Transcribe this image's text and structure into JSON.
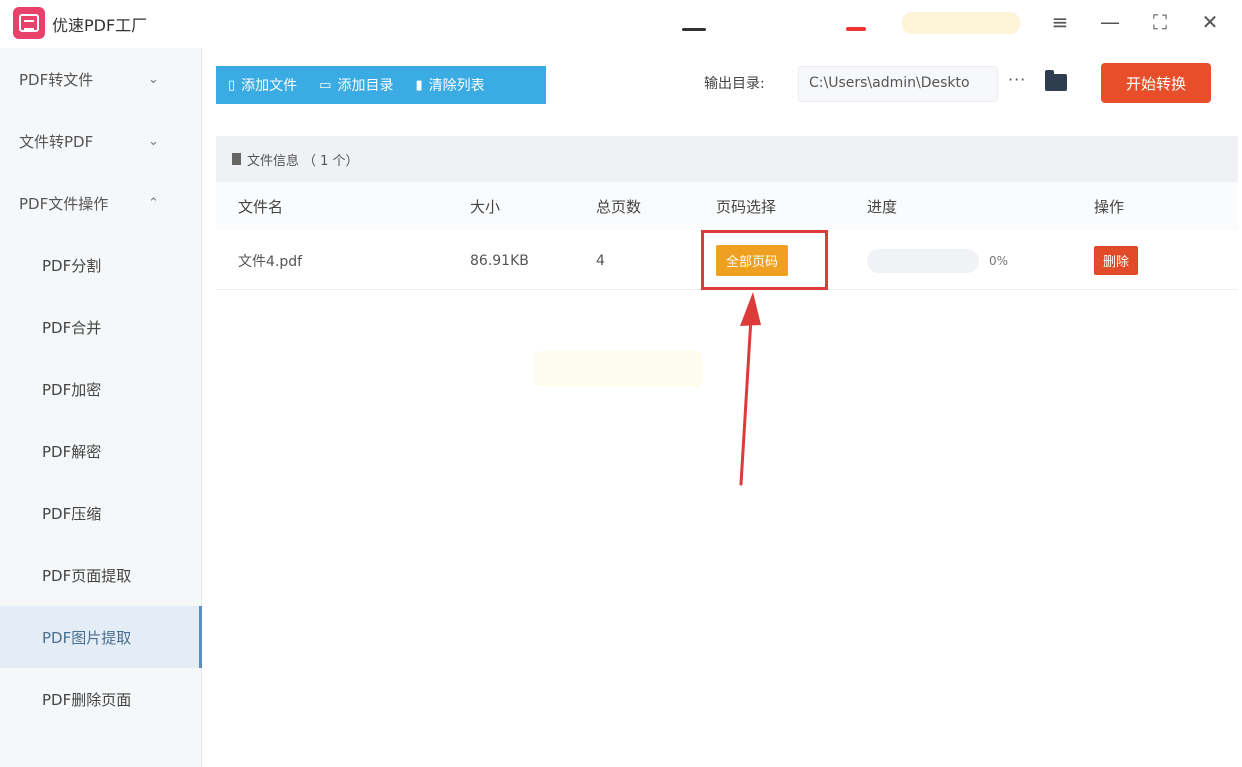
{
  "app": {
    "title": "优速PDF工厂"
  },
  "window_controls": [
    {
      "name": "menu-icon",
      "glyph": "≡"
    },
    {
      "name": "minimize-icon",
      "glyph": "—"
    },
    {
      "name": "maximize-icon",
      "glyph": "⛶"
    },
    {
      "name": "close-icon",
      "glyph": "✕"
    }
  ],
  "sidebar": {
    "items": [
      {
        "label": "PDF转文件",
        "chevron": "⌄"
      },
      {
        "label": "文件转PDF",
        "chevron": "⌄"
      },
      {
        "label": "PDF文件操作",
        "chevron": "⌃"
      },
      {
        "label": "PDF分割"
      },
      {
        "label": "PDF合并"
      },
      {
        "label": "PDF加密"
      },
      {
        "label": "PDF解密"
      },
      {
        "label": "PDF压缩"
      },
      {
        "label": "PDF页面提取"
      },
      {
        "label": "PDF图片提取",
        "active": true
      },
      {
        "label": "PDF删除页面"
      }
    ]
  },
  "toolbar": {
    "add_file": "添加文件",
    "add_folder": "添加目录",
    "clear_list": "清除列表"
  },
  "output": {
    "label": "输出目录:",
    "path": "C:\\Users\\admin\\Deskto",
    "more": "···"
  },
  "start_button": "开始转换",
  "file_info": {
    "label": "文件信息",
    "count": "（ 1 个）"
  },
  "table": {
    "headers": {
      "name": "文件名",
      "size": "大小",
      "pages": "总页数",
      "page_select": "页码选择",
      "progress": "进度",
      "action": "操作"
    },
    "rows": [
      {
        "name": "文件4.pdf",
        "size": "86.91KB",
        "pages": "4",
        "page_select": "全部页码",
        "progress_text": "0%",
        "progress": 0,
        "action": "删除"
      }
    ]
  },
  "colors": {
    "accent_blue": "#3aabe3",
    "start_red": "#e94e2a",
    "page_select_orange": "#f0a020",
    "delete_red": "#e14b2a",
    "annotation_red": "#dd3a3a"
  }
}
